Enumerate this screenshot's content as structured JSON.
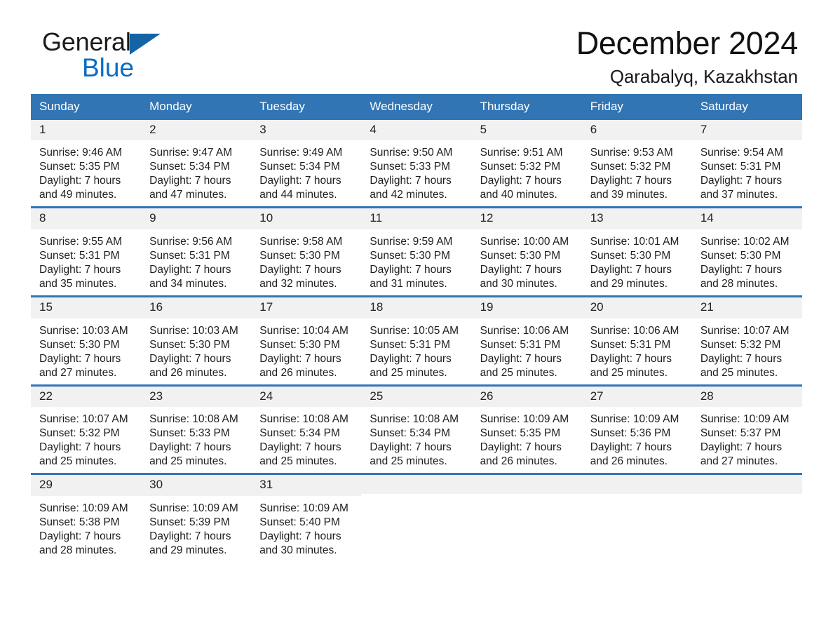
{
  "brand": {
    "name_part1": "General",
    "name_part2": "Blue",
    "triangle_color": "#1464a5",
    "blue_color": "#0a6cc4"
  },
  "header": {
    "title": "December 2024",
    "subtitle": "Qarabalyq, Kazakhstan"
  },
  "theme": {
    "header_bg": "#3175b5",
    "row_divider": "#2f76b6",
    "daynum_bg": "#f1f1f1",
    "text": "#1d1d1d"
  },
  "calendar": {
    "weekday_headers": [
      "Sunday",
      "Monday",
      "Tuesday",
      "Wednesday",
      "Thursday",
      "Friday",
      "Saturday"
    ],
    "weeks": [
      [
        {
          "day": "1",
          "sunrise": "Sunrise: 9:46 AM",
          "sunset": "Sunset: 5:35 PM",
          "daylight_line1": "Daylight: 7 hours",
          "daylight_line2": "and 49 minutes."
        },
        {
          "day": "2",
          "sunrise": "Sunrise: 9:47 AM",
          "sunset": "Sunset: 5:34 PM",
          "daylight_line1": "Daylight: 7 hours",
          "daylight_line2": "and 47 minutes."
        },
        {
          "day": "3",
          "sunrise": "Sunrise: 9:49 AM",
          "sunset": "Sunset: 5:34 PM",
          "daylight_line1": "Daylight: 7 hours",
          "daylight_line2": "and 44 minutes."
        },
        {
          "day": "4",
          "sunrise": "Sunrise: 9:50 AM",
          "sunset": "Sunset: 5:33 PM",
          "daylight_line1": "Daylight: 7 hours",
          "daylight_line2": "and 42 minutes."
        },
        {
          "day": "5",
          "sunrise": "Sunrise: 9:51 AM",
          "sunset": "Sunset: 5:32 PM",
          "daylight_line1": "Daylight: 7 hours",
          "daylight_line2": "and 40 minutes."
        },
        {
          "day": "6",
          "sunrise": "Sunrise: 9:53 AM",
          "sunset": "Sunset: 5:32 PM",
          "daylight_line1": "Daylight: 7 hours",
          "daylight_line2": "and 39 minutes."
        },
        {
          "day": "7",
          "sunrise": "Sunrise: 9:54 AM",
          "sunset": "Sunset: 5:31 PM",
          "daylight_line1": "Daylight: 7 hours",
          "daylight_line2": "and 37 minutes."
        }
      ],
      [
        {
          "day": "8",
          "sunrise": "Sunrise: 9:55 AM",
          "sunset": "Sunset: 5:31 PM",
          "daylight_line1": "Daylight: 7 hours",
          "daylight_line2": "and 35 minutes."
        },
        {
          "day": "9",
          "sunrise": "Sunrise: 9:56 AM",
          "sunset": "Sunset: 5:31 PM",
          "daylight_line1": "Daylight: 7 hours",
          "daylight_line2": "and 34 minutes."
        },
        {
          "day": "10",
          "sunrise": "Sunrise: 9:58 AM",
          "sunset": "Sunset: 5:30 PM",
          "daylight_line1": "Daylight: 7 hours",
          "daylight_line2": "and 32 minutes."
        },
        {
          "day": "11",
          "sunrise": "Sunrise: 9:59 AM",
          "sunset": "Sunset: 5:30 PM",
          "daylight_line1": "Daylight: 7 hours",
          "daylight_line2": "and 31 minutes."
        },
        {
          "day": "12",
          "sunrise": "Sunrise: 10:00 AM",
          "sunset": "Sunset: 5:30 PM",
          "daylight_line1": "Daylight: 7 hours",
          "daylight_line2": "and 30 minutes."
        },
        {
          "day": "13",
          "sunrise": "Sunrise: 10:01 AM",
          "sunset": "Sunset: 5:30 PM",
          "daylight_line1": "Daylight: 7 hours",
          "daylight_line2": "and 29 minutes."
        },
        {
          "day": "14",
          "sunrise": "Sunrise: 10:02 AM",
          "sunset": "Sunset: 5:30 PM",
          "daylight_line1": "Daylight: 7 hours",
          "daylight_line2": "and 28 minutes."
        }
      ],
      [
        {
          "day": "15",
          "sunrise": "Sunrise: 10:03 AM",
          "sunset": "Sunset: 5:30 PM",
          "daylight_line1": "Daylight: 7 hours",
          "daylight_line2": "and 27 minutes."
        },
        {
          "day": "16",
          "sunrise": "Sunrise: 10:03 AM",
          "sunset": "Sunset: 5:30 PM",
          "daylight_line1": "Daylight: 7 hours",
          "daylight_line2": "and 26 minutes."
        },
        {
          "day": "17",
          "sunrise": "Sunrise: 10:04 AM",
          "sunset": "Sunset: 5:30 PM",
          "daylight_line1": "Daylight: 7 hours",
          "daylight_line2": "and 26 minutes."
        },
        {
          "day": "18",
          "sunrise": "Sunrise: 10:05 AM",
          "sunset": "Sunset: 5:31 PM",
          "daylight_line1": "Daylight: 7 hours",
          "daylight_line2": "and 25 minutes."
        },
        {
          "day": "19",
          "sunrise": "Sunrise: 10:06 AM",
          "sunset": "Sunset: 5:31 PM",
          "daylight_line1": "Daylight: 7 hours",
          "daylight_line2": "and 25 minutes."
        },
        {
          "day": "20",
          "sunrise": "Sunrise: 10:06 AM",
          "sunset": "Sunset: 5:31 PM",
          "daylight_line1": "Daylight: 7 hours",
          "daylight_line2": "and 25 minutes."
        },
        {
          "day": "21",
          "sunrise": "Sunrise: 10:07 AM",
          "sunset": "Sunset: 5:32 PM",
          "daylight_line1": "Daylight: 7 hours",
          "daylight_line2": "and 25 minutes."
        }
      ],
      [
        {
          "day": "22",
          "sunrise": "Sunrise: 10:07 AM",
          "sunset": "Sunset: 5:32 PM",
          "daylight_line1": "Daylight: 7 hours",
          "daylight_line2": "and 25 minutes."
        },
        {
          "day": "23",
          "sunrise": "Sunrise: 10:08 AM",
          "sunset": "Sunset: 5:33 PM",
          "daylight_line1": "Daylight: 7 hours",
          "daylight_line2": "and 25 minutes."
        },
        {
          "day": "24",
          "sunrise": "Sunrise: 10:08 AM",
          "sunset": "Sunset: 5:34 PM",
          "daylight_line1": "Daylight: 7 hours",
          "daylight_line2": "and 25 minutes."
        },
        {
          "day": "25",
          "sunrise": "Sunrise: 10:08 AM",
          "sunset": "Sunset: 5:34 PM",
          "daylight_line1": "Daylight: 7 hours",
          "daylight_line2": "and 25 minutes."
        },
        {
          "day": "26",
          "sunrise": "Sunrise: 10:09 AM",
          "sunset": "Sunset: 5:35 PM",
          "daylight_line1": "Daylight: 7 hours",
          "daylight_line2": "and 26 minutes."
        },
        {
          "day": "27",
          "sunrise": "Sunrise: 10:09 AM",
          "sunset": "Sunset: 5:36 PM",
          "daylight_line1": "Daylight: 7 hours",
          "daylight_line2": "and 26 minutes."
        },
        {
          "day": "28",
          "sunrise": "Sunrise: 10:09 AM",
          "sunset": "Sunset: 5:37 PM",
          "daylight_line1": "Daylight: 7 hours",
          "daylight_line2": "and 27 minutes."
        }
      ],
      [
        {
          "day": "29",
          "sunrise": "Sunrise: 10:09 AM",
          "sunset": "Sunset: 5:38 PM",
          "daylight_line1": "Daylight: 7 hours",
          "daylight_line2": "and 28 minutes."
        },
        {
          "day": "30",
          "sunrise": "Sunrise: 10:09 AM",
          "sunset": "Sunset: 5:39 PM",
          "daylight_line1": "Daylight: 7 hours",
          "daylight_line2": "and 29 minutes."
        },
        {
          "day": "31",
          "sunrise": "Sunrise: 10:09 AM",
          "sunset": "Sunset: 5:40 PM",
          "daylight_line1": "Daylight: 7 hours",
          "daylight_line2": "and 30 minutes."
        },
        {
          "day": "",
          "sunrise": "",
          "sunset": "",
          "daylight_line1": "",
          "daylight_line2": ""
        },
        {
          "day": "",
          "sunrise": "",
          "sunset": "",
          "daylight_line1": "",
          "daylight_line2": ""
        },
        {
          "day": "",
          "sunrise": "",
          "sunset": "",
          "daylight_line1": "",
          "daylight_line2": ""
        },
        {
          "day": "",
          "sunrise": "",
          "sunset": "",
          "daylight_line1": "",
          "daylight_line2": ""
        }
      ]
    ]
  }
}
